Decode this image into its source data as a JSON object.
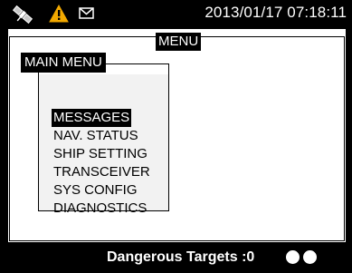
{
  "status_bar": {
    "icons": [
      "satellite-icon",
      "warning-icon",
      "mail-icon"
    ],
    "datetime": "2013/01/17 07:18:11"
  },
  "screen": {
    "title": "MENU"
  },
  "main_menu": {
    "title": "MAIN MENU",
    "selected_index": 0,
    "items": [
      {
        "label": "MESSAGES"
      },
      {
        "label": "NAV. STATUS"
      },
      {
        "label": "SHIP SETTING"
      },
      {
        "label": "TRANSCEIVER"
      },
      {
        "label": "SYS CONFIG"
      },
      {
        "label": "DIAGNOSTICS"
      }
    ]
  },
  "footer": {
    "targets_label": "Dangerous Targets :0"
  },
  "colors": {
    "bezel": "#000000",
    "screen": "#ffffff",
    "warning": "#f2a900",
    "menu_panel": "#f2f2f2"
  }
}
